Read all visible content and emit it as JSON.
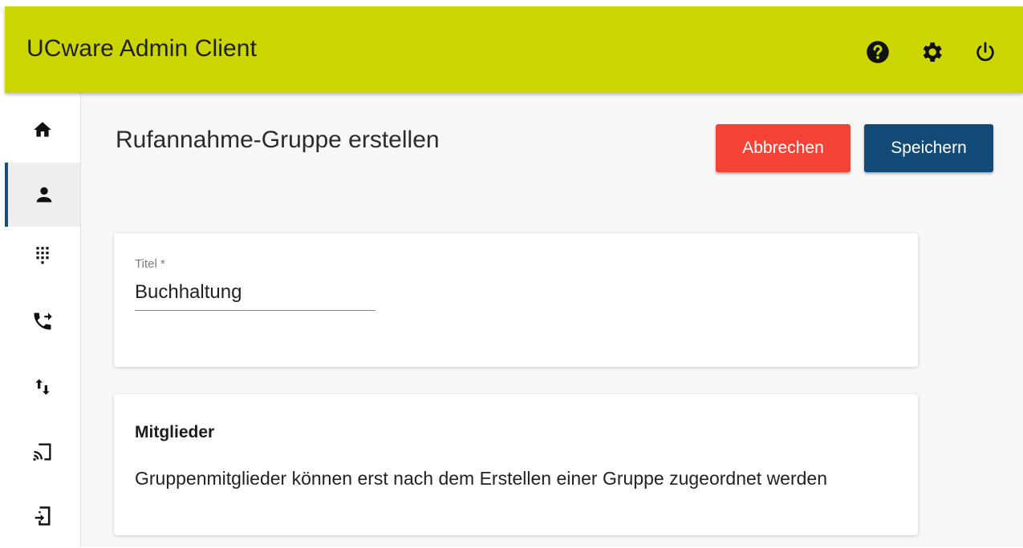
{
  "header": {
    "app_title": "UCware Admin Client",
    "icons": [
      "help-icon",
      "settings-gear-icon",
      "power-icon"
    ]
  },
  "sidebar": {
    "items": [
      {
        "icon": "home-icon",
        "active": false
      },
      {
        "icon": "person-icon",
        "active": true
      },
      {
        "icon": "dialpad-icon",
        "active": false
      },
      {
        "icon": "phone-forward-icon",
        "active": false
      },
      {
        "icon": "swap-vert-icon",
        "active": false
      },
      {
        "icon": "cast-icon",
        "active": false
      },
      {
        "icon": "phone-login-icon",
        "active": false
      }
    ]
  },
  "main": {
    "page_title": "Rufannahme-Gruppe erstellen",
    "cancel_label": "Abbrechen",
    "save_label": "Speichern",
    "title_field": {
      "label": "Titel *",
      "value": "Buchhaltung"
    },
    "members": {
      "heading": "Mitglieder",
      "text": "Gruppenmitglieder können erst nach dem Erstellen einer Gruppe zugeordnet werden"
    }
  },
  "colors": {
    "header_bg": "#cbd500",
    "cancel_bg": "#f44336",
    "save_bg": "#134b78",
    "active_indicator": "#1b4f72"
  }
}
